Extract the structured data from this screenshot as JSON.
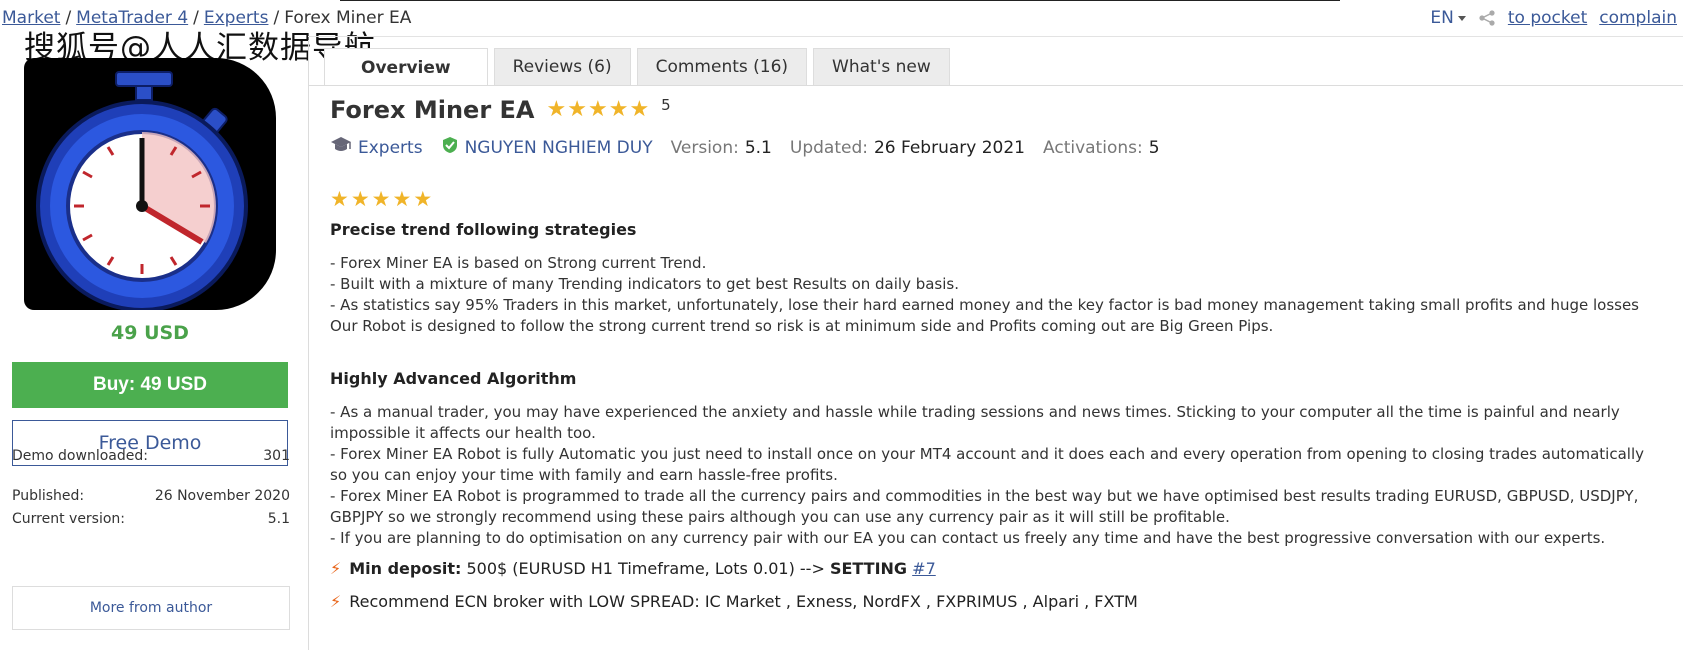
{
  "breadcrumb": {
    "items": [
      "Market",
      "MetaTrader 4",
      "Experts",
      "Forex Miner EA"
    ],
    "separator": "/"
  },
  "overlay_watermark": "搜狐号@人人汇数据导航",
  "top_right": {
    "language": "EN",
    "to_pocket": "to pocket",
    "complain": "complain"
  },
  "sidebar": {
    "price": "49 USD",
    "buy_label": "Buy: 49 USD",
    "demo_label": "Free Demo",
    "stats": [
      {
        "label": "Demo downloaded:",
        "value": "301"
      },
      {
        "label": "Published:",
        "value": "26 November 2020"
      },
      {
        "label": "Current version:",
        "value": "5.1"
      }
    ],
    "more_from_author": "More from author"
  },
  "tabs": [
    {
      "label": "Overview",
      "active": true
    },
    {
      "label": "Reviews (6)",
      "active": false
    },
    {
      "label": "Comments (16)",
      "active": false
    },
    {
      "label": "What's new",
      "active": false
    }
  ],
  "product": {
    "title": "Forex Miner EA",
    "rating": 5,
    "rating_count": "5",
    "category": "Experts",
    "author": "NGUYEN NGHIEM DUY",
    "version_label": "Version:",
    "version": "5.1",
    "updated_label": "Updated:",
    "updated": "26 February 2021",
    "activations_label": "Activations:",
    "activations": "5"
  },
  "description": {
    "section1_title": "Precise trend following strategies",
    "section1_lines": [
      "- Forex Miner EA is based on Strong current Trend.",
      "- Built with a mixture of many Trending indicators to get best Results on daily basis.",
      "- As statistics say 95% Traders in this market, unfortunately, lose their hard earned money and the key factor is bad money management taking small profits and huge losses Our Robot is designed to follow the strong current trend so risk is at minimum side and Profits coming out are Big Green Pips."
    ],
    "section2_title": "Highly Advanced Algorithm",
    "section2_lines": [
      "- As a manual trader, you may have experienced the anxiety and hassle while trading sessions and news times. Sticking to your computer all the time is painful and nearly impossible it affects our health too.",
      "- Forex Miner EA Robot is fully Automatic you just need to install once on your MT4 account and it does each and every operation from opening to closing trades automatically so you can enjoy your time with family and earn hassle-free profits.",
      "- Forex Miner EA Robot is programmed to trade all the currency pairs and commodities in the best way but we have optimised best results trading EURUSD, GBPUSD, USDJPY, GBPJPY so we strongly recommend using these pairs although you can use any currency pair as it will still be profitable.",
      "- If you are planning to do optimisation on any currency pair with our EA you can contact us freely any time and have the best progressive conversation with our experts."
    ],
    "deposit_label": "Min deposit:",
    "deposit_value": "500$ (EURUSD H1 Timeframe, Lots 0.01) --> ",
    "setting_label": "SETTING",
    "setting_link": "#7",
    "broker_text": "Recommend ECN broker with LOW SPREAD: IC Market , Exness, NordFX , FXPRIMUS , Alpari , FXTM"
  },
  "colors": {
    "buy_green": "#4caf50",
    "price_green": "#4aa24a",
    "link_blue": "#3b5998",
    "star_gold": "#f0b429"
  }
}
